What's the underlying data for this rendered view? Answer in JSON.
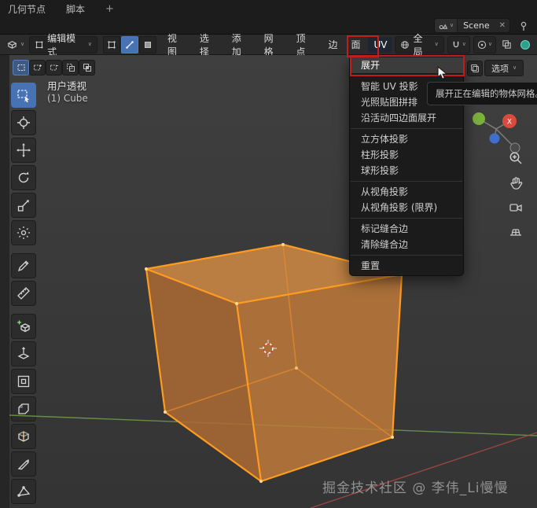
{
  "topbar": {
    "tabs": [
      "几何节点",
      "脚本"
    ],
    "new_tab_label": "+",
    "scene_name": "Scene"
  },
  "header": {
    "mode_label": "编辑模式",
    "menus": [
      "视图",
      "选择",
      "添加",
      "网格",
      "顶点",
      "边",
      "面",
      "UV"
    ],
    "orientation_label": "全局",
    "options_label": "选项"
  },
  "viewport": {
    "view_label": "用户透视",
    "object_info": "(1) Cube",
    "watermark": "掘金技术社区 @ 李伟_Li慢慢"
  },
  "uv_menu": {
    "items": [
      "展开",
      "智能 UV 投影",
      "光照贴图拼排",
      "沿活动四边面展开",
      "立方体投影",
      "柱形投影",
      "球形投影",
      "从视角投影",
      "从视角投影 (限界)",
      "标记缝合边",
      "清除缝合边",
      "重置"
    ]
  },
  "tooltip": {
    "text": "展开正在编辑的物体网格。"
  },
  "gizmo": {
    "x_label": "X"
  },
  "icons": {
    "close": "✕",
    "caret_down": "∨"
  },
  "colors": {
    "accent_blue": "#4772b3",
    "selection_orange": "#ff9a1e",
    "annotation_red": "#c21d1d",
    "axis_green": "#6f9f42",
    "axis_red": "#b04848",
    "gizmo_x": "#d94c3d",
    "gizmo_y": "#7ab03c",
    "gizmo_z": "#3f6fca",
    "shading_teal": "#2fa08c"
  }
}
